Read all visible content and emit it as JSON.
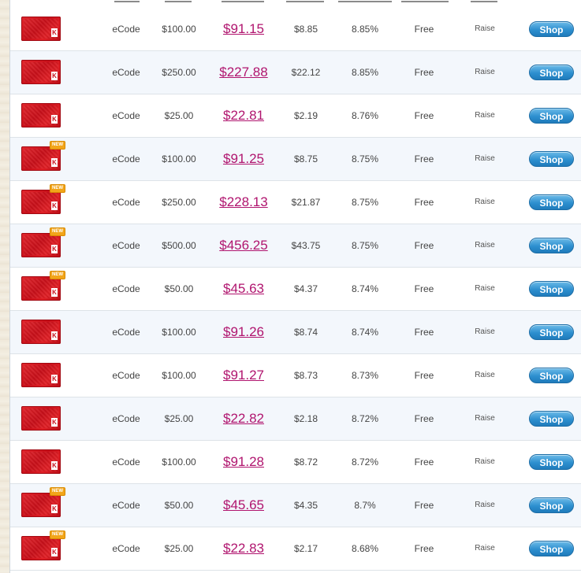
{
  "listings": [
    {
      "type": "eCode",
      "value": "$100.00",
      "price": "$91.15",
      "savings": "$8.85",
      "percent": "8.85%",
      "shipping": "Free",
      "seller": "Raise",
      "action": "Shop",
      "is_new": false
    },
    {
      "type": "eCode",
      "value": "$250.00",
      "price": "$227.88",
      "savings": "$22.12",
      "percent": "8.85%",
      "shipping": "Free",
      "seller": "Raise",
      "action": "Shop",
      "is_new": false
    },
    {
      "type": "eCode",
      "value": "$25.00",
      "price": "$22.81",
      "savings": "$2.19",
      "percent": "8.76%",
      "shipping": "Free",
      "seller": "Raise",
      "action": "Shop",
      "is_new": false
    },
    {
      "type": "eCode",
      "value": "$100.00",
      "price": "$91.25",
      "savings": "$8.75",
      "percent": "8.75%",
      "shipping": "Free",
      "seller": "Raise",
      "action": "Shop",
      "is_new": true
    },
    {
      "type": "eCode",
      "value": "$250.00",
      "price": "$228.13",
      "savings": "$21.87",
      "percent": "8.75%",
      "shipping": "Free",
      "seller": "Raise",
      "action": "Shop",
      "is_new": true
    },
    {
      "type": "eCode",
      "value": "$500.00",
      "price": "$456.25",
      "savings": "$43.75",
      "percent": "8.75%",
      "shipping": "Free",
      "seller": "Raise",
      "action": "Shop",
      "is_new": true
    },
    {
      "type": "eCode",
      "value": "$50.00",
      "price": "$45.63",
      "savings": "$4.37",
      "percent": "8.74%",
      "shipping": "Free",
      "seller": "Raise",
      "action": "Shop",
      "is_new": true
    },
    {
      "type": "eCode",
      "value": "$100.00",
      "price": "$91.26",
      "savings": "$8.74",
      "percent": "8.74%",
      "shipping": "Free",
      "seller": "Raise",
      "action": "Shop",
      "is_new": false
    },
    {
      "type": "eCode",
      "value": "$100.00",
      "price": "$91.27",
      "savings": "$8.73",
      "percent": "8.73%",
      "shipping": "Free",
      "seller": "Raise",
      "action": "Shop",
      "is_new": false
    },
    {
      "type": "eCode",
      "value": "$25.00",
      "price": "$22.82",
      "savings": "$2.18",
      "percent": "8.72%",
      "shipping": "Free",
      "seller": "Raise",
      "action": "Shop",
      "is_new": false
    },
    {
      "type": "eCode",
      "value": "$100.00",
      "price": "$91.28",
      "savings": "$8.72",
      "percent": "8.72%",
      "shipping": "Free",
      "seller": "Raise",
      "action": "Shop",
      "is_new": false
    },
    {
      "type": "eCode",
      "value": "$50.00",
      "price": "$45.65",
      "savings": "$4.35",
      "percent": "8.7%",
      "shipping": "Free",
      "seller": "Raise",
      "action": "Shop",
      "is_new": true
    },
    {
      "type": "eCode",
      "value": "$25.00",
      "price": "$22.83",
      "savings": "$2.17",
      "percent": "8.68%",
      "shipping": "Free",
      "seller": "Raise",
      "action": "Shop",
      "is_new": true
    }
  ],
  "badges": {
    "new": "NEW"
  },
  "card_logo": "K",
  "colors": {
    "price": "#b0146e",
    "button": "#2d8fcf",
    "row_alt": "#f3f7fc",
    "card": "#c8101a"
  }
}
